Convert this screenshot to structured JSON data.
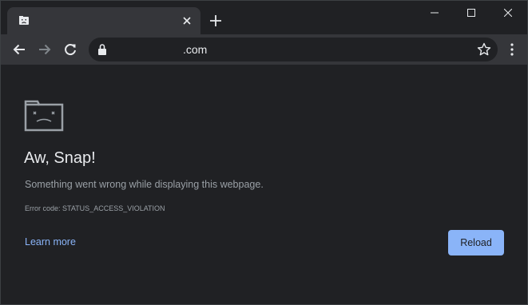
{
  "tab": {
    "favicon": "sad-tab-icon",
    "title": ""
  },
  "window_controls": [
    "minimize-icon",
    "maximize-icon",
    "close-icon"
  ],
  "toolbar": {
    "url": ".com",
    "icons": [
      "back-arrow-icon",
      "forward-arrow-icon",
      "reload-icon",
      "lock-icon",
      "star-icon",
      "kebab-menu-icon"
    ]
  },
  "error_page": {
    "icon": "sad-folder-icon",
    "heading": "Aw, Snap!",
    "message": "Something went wrong while displaying this webpage.",
    "error_code": "Error code: STATUS_ACCESS_VIOLATION",
    "learn_more_label": "Learn more",
    "reload_label": "Reload"
  },
  "colors": {
    "background": "#202124",
    "toolbar": "#35363a",
    "text_primary": "#e8eaed",
    "text_secondary": "#9aa0a6",
    "accent": "#8ab4f8"
  }
}
